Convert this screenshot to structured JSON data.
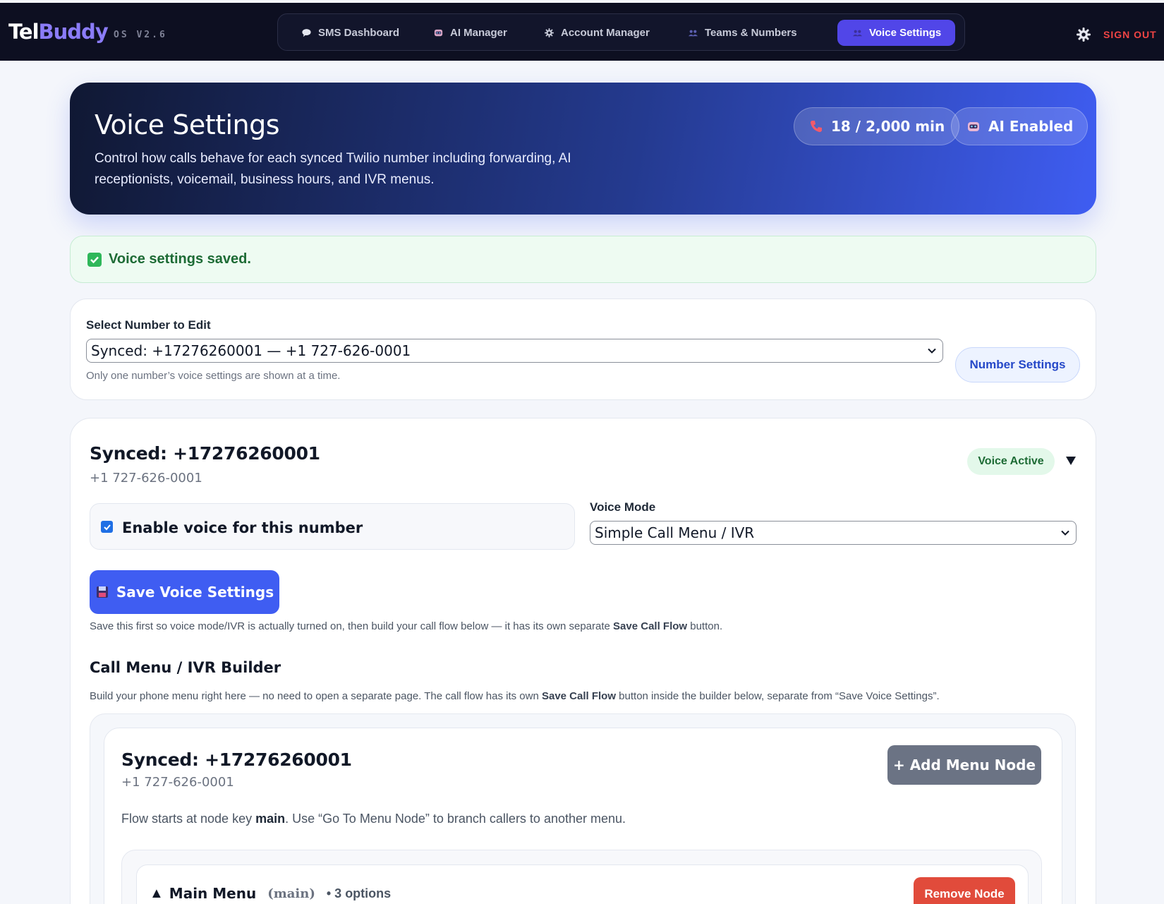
{
  "brand": {
    "part1": "Tel",
    "part2": "Buddy",
    "version": "OS V2.6"
  },
  "nav": {
    "items": [
      {
        "label": "SMS Dashboard",
        "icon": "chat-bubble-icon"
      },
      {
        "label": "AI Manager",
        "icon": "robot-icon"
      },
      {
        "label": "Account Manager",
        "icon": "gear-icon"
      },
      {
        "label": "Teams & Numbers",
        "icon": "people-icon"
      },
      {
        "label": "Voice Settings",
        "icon": "people-icon",
        "active": true
      }
    ],
    "sign_out": "SIGN OUT"
  },
  "hero": {
    "title": "Voice Settings",
    "description": "Control how calls behave for each synced Twilio number including forwarding, AI receptionists, voicemail, business hours, and IVR menus.",
    "usage_badge": "18 / 2,000 min",
    "ai_badge": "AI Enabled"
  },
  "alert": {
    "message": "Voice settings saved.",
    "color": "#2fb75a"
  },
  "selector": {
    "label": "Select Number to Edit",
    "selected": "Synced: +17276260001 — +1 727-626-0001",
    "hint": "Only one number’s voice settings are shown at a time.",
    "button": "Number Settings"
  },
  "voice": {
    "title": "Synced: +17276260001",
    "phone": "+1 727-626-0001",
    "status": "Voice Active",
    "enable_label": "Enable voice for this number",
    "enable_checked": true,
    "mode_label": "Voice Mode",
    "mode_value": "Simple Call Menu / IVR",
    "save_button": "Save Voice Settings",
    "save_note_pre": "Save this first so voice mode/IVR is actually turned on, then build your call flow below — it has its own separate ",
    "save_note_bold": "Save Call Flow",
    "save_note_post": " button.",
    "accent": "#3f5df2"
  },
  "builder": {
    "heading": "Call Menu / IVR Builder",
    "desc_pre": "Build your phone menu right here — no need to open a separate page. The call flow has its own ",
    "desc_bold": "Save Call Flow",
    "desc_post": " button inside the builder below, separate from “Save Voice Settings”.",
    "title": "Synced: +17276260001",
    "phone": "+1 727-626-0001",
    "add_button": "+ Add Menu Node",
    "flow_pre": "Flow starts at node key ",
    "flow_bold": "main",
    "flow_post": ". Use “Go To Menu Node” to branch callers to another menu.",
    "node": {
      "toggle": "▲",
      "name": "Main Menu",
      "key": "(main)",
      "options": "• 3 options",
      "remove_button": "Remove Node"
    }
  }
}
